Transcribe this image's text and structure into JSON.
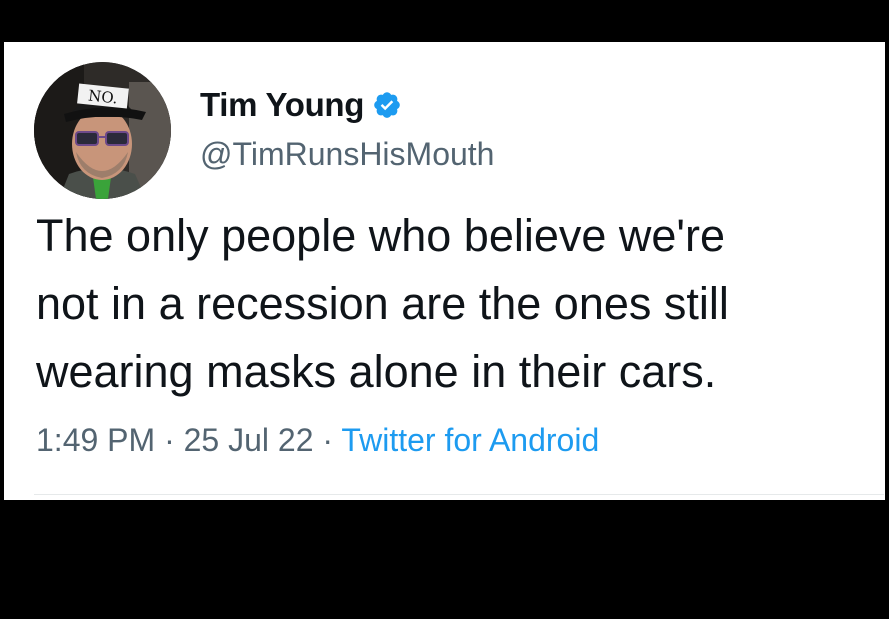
{
  "tweet": {
    "author_name": "Tim Young",
    "handle": "@TimRunsHisMouth",
    "verified": true,
    "avatar_hat_text": "NO.",
    "text_lines": [
      "The only people who believe we're",
      "not in a recession are the ones still",
      "wearing masks alone in their cars."
    ],
    "time": "1:49 PM",
    "separator": " · ",
    "date": "25 Jul 22",
    "source": "Twitter for Android"
  },
  "colors": {
    "text_primary": "#0f1419",
    "text_secondary": "#536471",
    "accent": "#1d9bf0",
    "background": "#ffffff",
    "frame": "#000000"
  }
}
